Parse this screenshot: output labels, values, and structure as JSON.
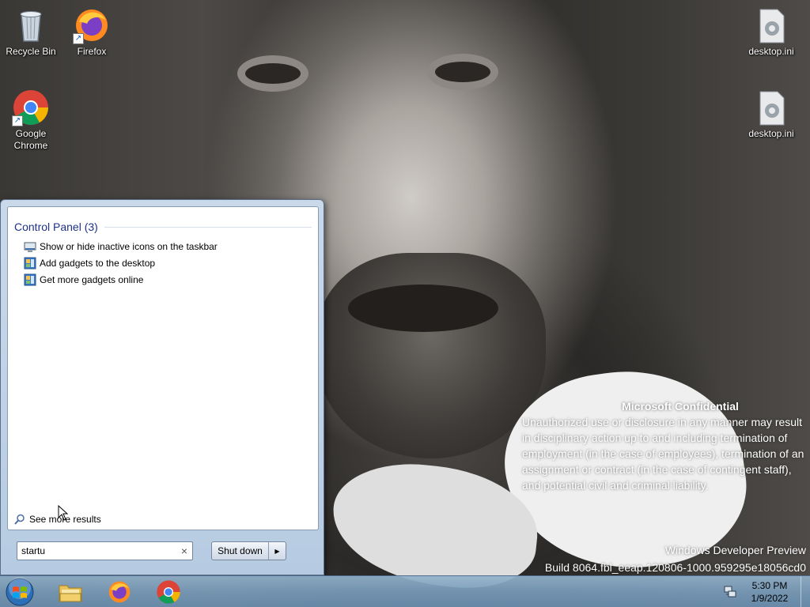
{
  "desktop": {
    "icons": [
      {
        "label": "Recycle Bin",
        "icon": "recycle-bin-icon"
      },
      {
        "label": "Firefox",
        "icon": "firefox-icon"
      },
      {
        "label": "Google\nChrome",
        "icon": "chrome-icon"
      },
      {
        "label": "desktop.ini",
        "icon": "ini-file-icon"
      },
      {
        "label": "desktop.ini",
        "icon": "ini-file-icon"
      }
    ]
  },
  "watermark": {
    "title": "Microsoft Confidential",
    "body": "Unauthorized use or disclosure in any manner may result in disciplinary action up to and including termination of employment (in the case of employees), termination of an assignment or contract (in the case of contingent staff), and potential civil and criminal liability.",
    "edition": "Windows Developer Preview",
    "build": "Build 8064.fbl_eeap.120806-1000.959295e18056cd0"
  },
  "start_menu": {
    "group_title": "Control Panel (3)",
    "results": [
      {
        "label": "Show or hide inactive icons on the taskbar",
        "icon": "taskbar-settings-icon"
      },
      {
        "label": "Add gadgets to the desktop",
        "icon": "gadgets-icon"
      },
      {
        "label": "Get more gadgets online",
        "icon": "gadgets-icon"
      }
    ],
    "see_more": "See more results",
    "search_value": "startu",
    "shutdown_label": "Shut down"
  },
  "taskbar": {
    "apps": [
      "file-explorer-icon",
      "firefox-icon",
      "chrome-icon"
    ],
    "time": "5:30 PM",
    "date": "1/9/2022"
  },
  "colors": {
    "group_title": "#1e3287",
    "taskbar": "#7f9fbf"
  }
}
